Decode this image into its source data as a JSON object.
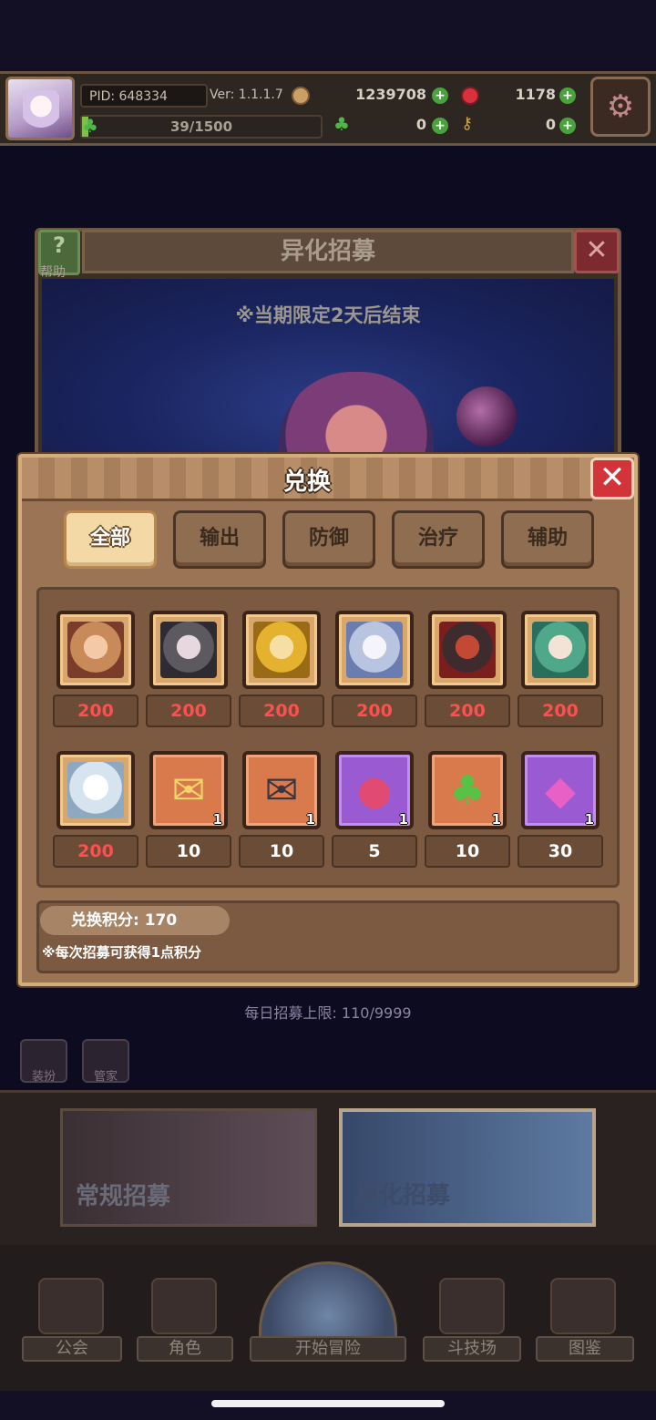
{
  "topbar": {
    "pid": "PID: 648334",
    "version": "Ver: 1.1.1.7",
    "gold": "1239708",
    "gems": "1178",
    "exp": "39/1500",
    "clovers": "0",
    "keys": "0"
  },
  "recruit": {
    "title": "异化招募",
    "help_label": "帮助",
    "period_note": "※当期限定2天后结束",
    "daily_limit": "每日招募上限: 110/9999",
    "normal_card": "常规招募",
    "alien_card": "异化招募"
  },
  "side_icons": [
    "装扮",
    "管家"
  ],
  "exchange": {
    "title": "兑换",
    "tabs": [
      "全部",
      "输出",
      "防御",
      "治疗",
      "辅助"
    ],
    "active_tab": "全部",
    "items": [
      {
        "type": "hero",
        "icon": "hero-portrait",
        "price": "200"
      },
      {
        "type": "hero",
        "icon": "hero-portrait",
        "price": "200"
      },
      {
        "type": "hero",
        "icon": "hero-portrait",
        "price": "200"
      },
      {
        "type": "hero",
        "icon": "hero-portrait",
        "price": "200"
      },
      {
        "type": "hero",
        "icon": "hero-portrait",
        "price": "200"
      },
      {
        "type": "hero",
        "icon": "hero-portrait",
        "price": "200"
      },
      {
        "type": "hero",
        "icon": "hero-portrait",
        "price": "200"
      },
      {
        "type": "item",
        "icon": "gold-letter-icon",
        "qty": "1",
        "price": "10"
      },
      {
        "type": "item",
        "icon": "dark-letter-icon",
        "qty": "1",
        "price": "10"
      },
      {
        "type": "item",
        "icon": "fruit-icon",
        "qty": "1",
        "price": "5"
      },
      {
        "type": "item",
        "icon": "clover-icon",
        "qty": "1",
        "price": "10"
      },
      {
        "type": "item",
        "icon": "crystal-icon",
        "qty": "1",
        "price": "30"
      }
    ],
    "points_label": "兑换积分: 170",
    "points_note": "※每次招募可获得1点积分"
  },
  "nav": [
    "公会",
    "角色",
    "开始冒险",
    "斗技场",
    "图鉴"
  ],
  "colors": {
    "modal_bg": "#9a7455",
    "hero_price": "#ff4f4f",
    "active_tab": "#f3d9a6"
  }
}
